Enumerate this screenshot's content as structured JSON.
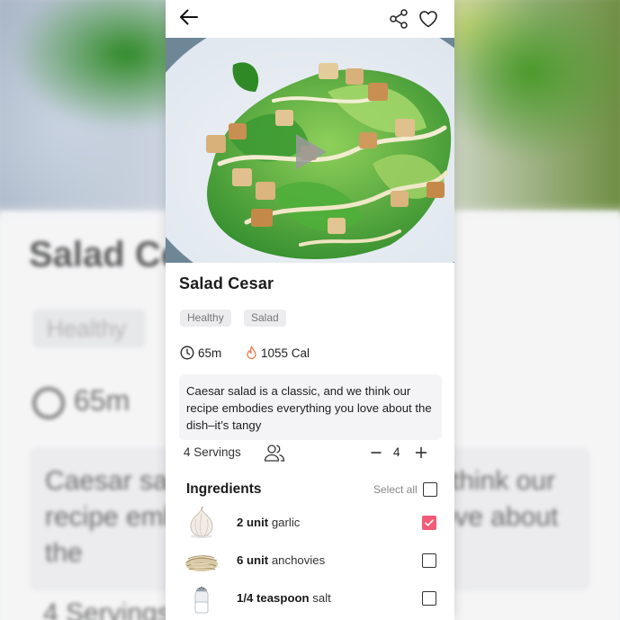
{
  "background": {
    "title": "Salad Ce",
    "tag": "Healthy",
    "time": "65m",
    "description": "Caesar salad is a classic, and we think our recipe embodies everything you love about the",
    "servings": "4 Servings"
  },
  "topbar": {
    "back_icon": "arrow-left-icon",
    "share_icon": "share-icon",
    "favorite_icon": "heart-icon"
  },
  "recipe": {
    "title": "Salad Cesar",
    "tags": [
      "Healthy",
      "Salad"
    ],
    "time": "65m",
    "calories": "1055 Cal",
    "description": "Caesar salad is a classic, and we think our recipe embodies everything you love about the dish–it’s tangy"
  },
  "servings": {
    "label": "4 Servings",
    "count": "4",
    "minus": "−",
    "plus": "+"
  },
  "ingredients": {
    "title": "Ingredients",
    "select_all": "Select all",
    "items": [
      {
        "qty": "2 unit",
        "name": " garlic",
        "checked": true
      },
      {
        "qty": "6 unit",
        "name": " anchovies",
        "checked": false
      },
      {
        "qty": "1/4 teaspoon",
        "name": " salt",
        "checked": false
      }
    ]
  },
  "colors": {
    "accent": "#f25a77",
    "flame": "#f07a50",
    "tag_bg": "#ececee",
    "desc_bg": "#f4f4f6"
  }
}
